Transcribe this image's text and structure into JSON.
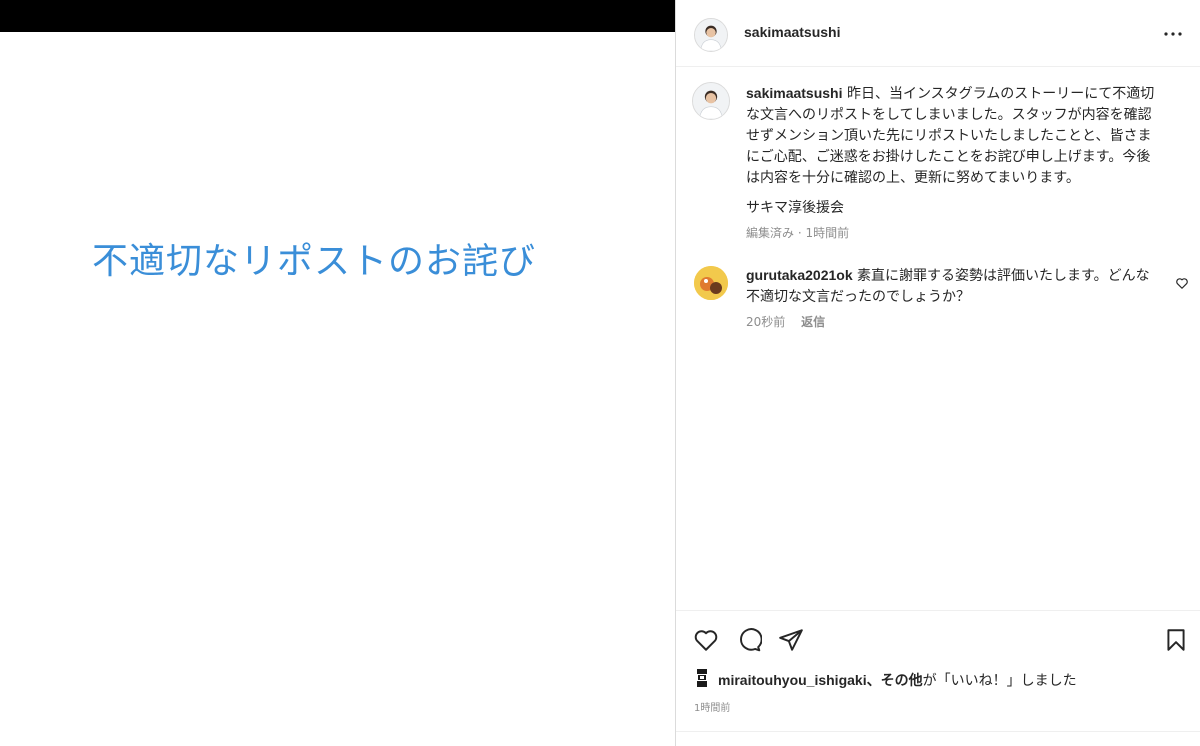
{
  "media": {
    "title_text": "不適切なリポストのお詫び"
  },
  "header": {
    "username": "sakimaatsushi",
    "more_icon": "more-horizontal-icon"
  },
  "caption": {
    "username": "sakimaatsushi",
    "text": " 昨日、当インスタグラムのストーリーにて不適切な文言へのリポストをしてしまいました。スタッフが内容を確認せずメンション頂いた先にリポストいたしましたことと、皆さまにご心配、ご迷惑をお掛けしたことをお詫び申し上げます。今後は内容を十分に確認の上、更新に努めてまいります。",
    "signoff": "サキマ淳後援会",
    "meta": "編集済み · 1時間前"
  },
  "comment": {
    "username": "gurutaka2021ok",
    "text": " 素直に謝罪する姿勢は評価いたします。どんな不適切な文言だったのでしょうか？",
    "time": "20秒前",
    "reply_label": "返信"
  },
  "likes": {
    "user": "miraitouhyou_ishigaki",
    "separator": "、",
    "others": "その他",
    "suffix": "が「いいね！」しました"
  },
  "post_time": "1時間前",
  "colors": {
    "media_text": "#3a8ed8",
    "muted": "#8e8e8e",
    "text": "#262626"
  }
}
